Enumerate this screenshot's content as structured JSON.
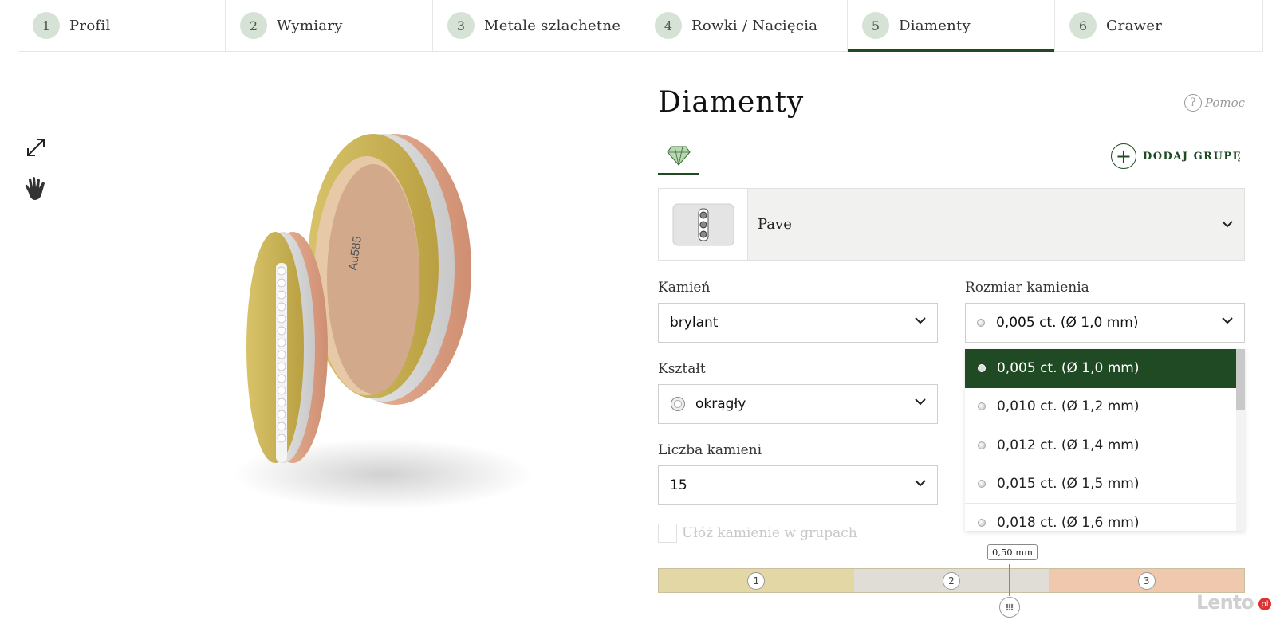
{
  "steps": [
    {
      "num": "1",
      "label": "Profil"
    },
    {
      "num": "2",
      "label": "Wymiary"
    },
    {
      "num": "3",
      "label": "Metale szlachetne"
    },
    {
      "num": "4",
      "label": "Rowki / Nacięcia"
    },
    {
      "num": "5",
      "label": "Diamenty"
    },
    {
      "num": "6",
      "label": "Grawer"
    }
  ],
  "active_step": 5,
  "tools": {
    "expand_icon": "expand-icon",
    "hand_icon": "hand-icon"
  },
  "ring_engraving": "Au585",
  "panel": {
    "title": "Diamenty",
    "help_label": "Pomoc",
    "help_icon": "?",
    "add_group_label": "DODAJ GRUPĘ",
    "add_group_icon": "+",
    "setting": "Pave",
    "stone_label": "Kamień",
    "stone_value": "brylant",
    "stone_size_label": "Rozmiar kamienia",
    "stone_size_value": "0,005 ct. (Ø 1,0 mm)",
    "shape_label": "Kształt",
    "shape_value": "okrągły",
    "count_label": "Liczba kamieni",
    "count_value": "15",
    "group_checkbox_label": "Ułóż kamienie w grupach",
    "group_checkbox_checked": false
  },
  "size_options": [
    "0,005 ct. (Ø 1,0 mm)",
    "0,010 ct. (Ø 1,2 mm)",
    "0,012 ct. (Ø 1,4 mm)",
    "0,015 ct. (Ø 1,5 mm)",
    "0,018 ct. (Ø 1,6 mm)"
  ],
  "size_selected_index": 0,
  "metal_bar": {
    "segments": [
      {
        "num": "1",
        "color": "#e3d7a5"
      },
      {
        "num": "2",
        "color": "#e0ddd6"
      },
      {
        "num": "3",
        "color": "#efc8ad"
      }
    ],
    "tooltip": "0,50 mm"
  },
  "colors": {
    "accent": "#1f4a24",
    "step_circle": "#d6e2d6"
  },
  "watermark": {
    "text": "Lento",
    "badge": "pl"
  }
}
